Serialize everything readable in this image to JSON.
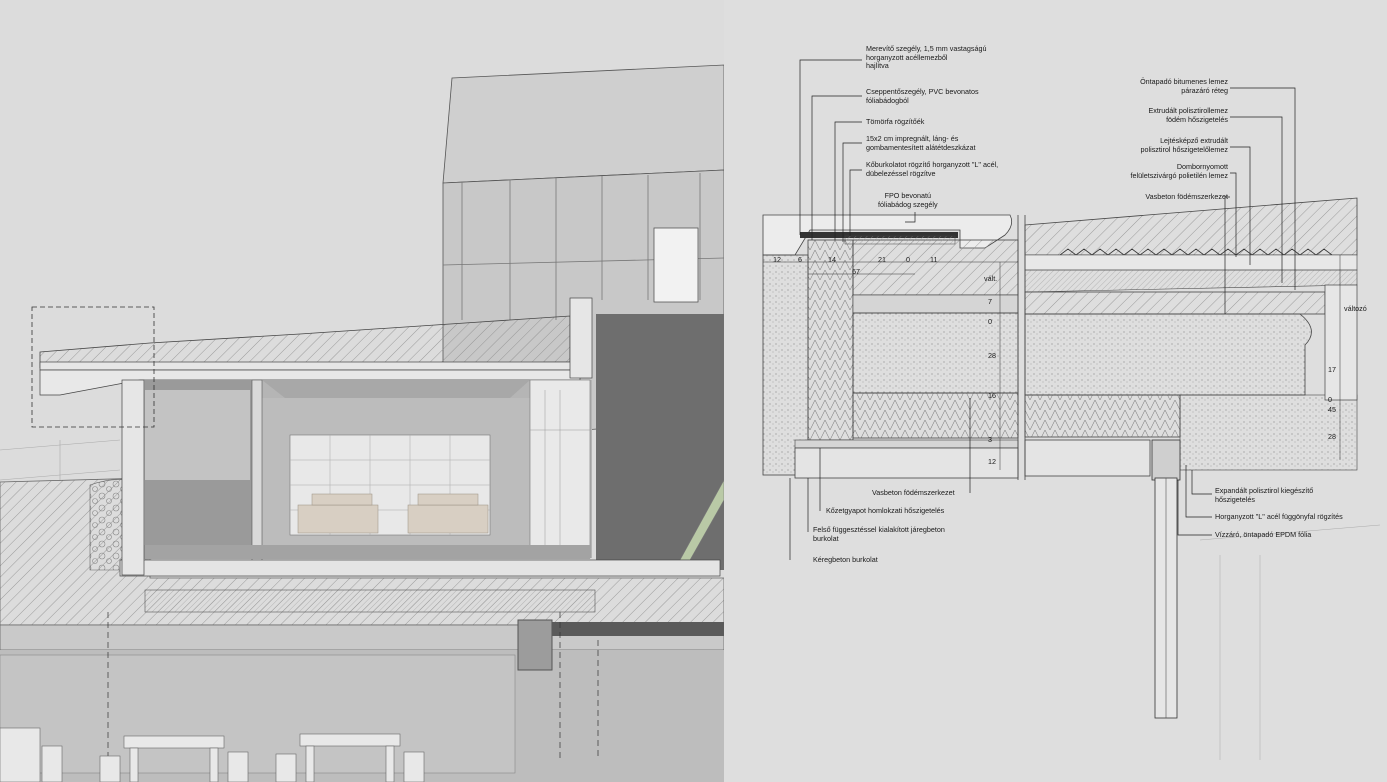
{
  "callouts_top": [
    {
      "text": "Merevítő szegély, 1,5 mm vastagságú\nhorganyzott acéllemezből\nhajlítva"
    },
    {
      "text": "Csepp​entőszegély, PVC bevonatos\nfóliabádogból"
    },
    {
      "text": "Tömörfa rögzítőék"
    },
    {
      "text": "15x2 cm impregnált, láng- és\ngombamentesített alátétdeszkázat"
    },
    {
      "text": "Kőburkolatot rögzítő horganyzott \"L\" acél,\ndübelezéssel rögzítve"
    },
    {
      "text": "FPO bevonatú\nfóliabádog szegély"
    }
  ],
  "callouts_right": [
    {
      "text": "Öntapadó bitumenes lemez\npárazáró réteg"
    },
    {
      "text": "Extrudált polisztirollemez\nfödém hőszigetelés"
    },
    {
      "text": "Lejtésképző extrudált\npolisztirol hőszigetelőlemez"
    },
    {
      "text": "Dombornyomott\nfelületszivárgó polietilén lemez"
    },
    {
      "text": "Vasbeton födémszerkezet"
    }
  ],
  "callouts_bottom": [
    {
      "text": "Vasbeton födémszerkezet"
    },
    {
      "text": "Kőzetgyapot homlokzati hőszigetelés"
    },
    {
      "text": "Felső függesztéssel kialakított járegbeton\nburkolat"
    },
    {
      "text": "Kéregbeton burkolat"
    }
  ],
  "callouts_bottom_right": [
    {
      "text": "Expandált polisztirol kiegészítő\nhőszigetelés"
    },
    {
      "text": "Horganyzott \"L\" acél függönyfal rögzítés"
    },
    {
      "text": "Vízzáró, öntapadó EPDM fólia"
    }
  ],
  "dimensions": {
    "top_row": [
      "12",
      "6",
      "14",
      "21",
      "0",
      "11"
    ],
    "sub_top": "67",
    "left_vertical": [
      "7",
      "0",
      "28",
      "16",
      "3",
      "12"
    ],
    "right_vertical": [
      "17",
      "0",
      "45",
      "28"
    ],
    "var_label": "vált.",
    "var_label2": "változó"
  },
  "colors": {
    "background": "#dcdcdc",
    "concrete": "#c4c4c4",
    "dark_wall": "#6e6e6e",
    "line": "#2a2a2a",
    "accent_green": "#b9c9a6"
  }
}
